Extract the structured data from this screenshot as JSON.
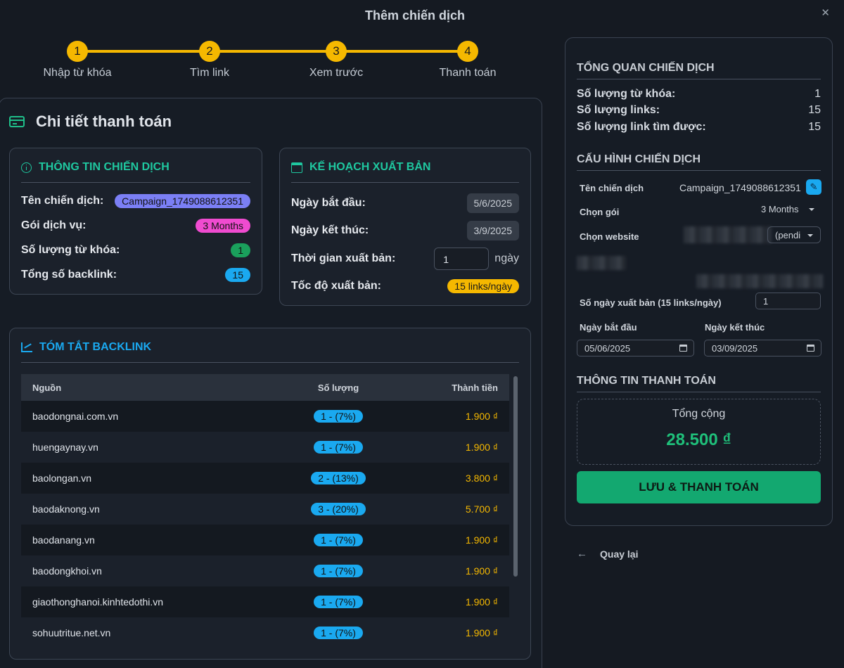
{
  "modal": {
    "title": "Thêm chiến dịch"
  },
  "stepper": [
    {
      "num": "1",
      "label": "Nhập từ khóa"
    },
    {
      "num": "2",
      "label": "Tìm link"
    },
    {
      "num": "3",
      "label": "Xem trước"
    },
    {
      "num": "4",
      "label": "Thanh toán"
    }
  ],
  "payment": {
    "title": "Chi tiết thanh toán"
  },
  "campaign_info": {
    "title": "THÔNG TIN CHIẾN DỊCH",
    "name_label": "Tên chiến dịch:",
    "name_value": "Campaign_1749088612351",
    "package_label": "Gói dịch vụ:",
    "package_value": "3 Months",
    "keywords_label": "Số lượng từ khóa:",
    "keywords_value": "1",
    "backlinks_label": "Tổng số backlink:",
    "backlinks_value": "15"
  },
  "plan": {
    "title": "KẾ HOẠCH XUẤT BẢN",
    "start_label": "Ngày bắt đầu:",
    "start_value": "5/6/2025",
    "end_label": "Ngày kết thúc:",
    "end_value": "3/9/2025",
    "duration_label": "Thời gian xuất bản:",
    "duration_value": "1",
    "duration_unit": "ngày",
    "speed_label": "Tốc độ xuất bản:",
    "speed_value": "15 links/ngày"
  },
  "backlinks": {
    "title": "TÓM TẮT BACKLINK",
    "headers": {
      "source": "Nguồn",
      "qty": "Số lượng",
      "amount": "Thành tiền"
    },
    "rows": [
      {
        "source": "baodongnai.com.vn",
        "qty": "1 - (7%)",
        "amount": "1.900 ₫"
      },
      {
        "source": "huengaynay.vn",
        "qty": "1 - (7%)",
        "amount": "1.900 ₫"
      },
      {
        "source": "baolongan.vn",
        "qty": "2 - (13%)",
        "amount": "3.800 ₫"
      },
      {
        "source": "baodaknong.vn",
        "qty": "3 - (20%)",
        "amount": "5.700 ₫"
      },
      {
        "source": "baodanang.vn",
        "qty": "1 - (7%)",
        "amount": "1.900 ₫"
      },
      {
        "source": "baodongkhoi.vn",
        "qty": "1 - (7%)",
        "amount": "1.900 ₫"
      },
      {
        "source": "giaothonghanoi.kinhtedothi.vn",
        "qty": "1 - (7%)",
        "amount": "1.900 ₫"
      },
      {
        "source": "sohuutritue.net.vn",
        "qty": "1 - (7%)",
        "amount": "1.900 ₫"
      }
    ]
  },
  "overview": {
    "title": "TỔNG QUAN CHIẾN DỊCH",
    "keywords_label": "Số lượng từ khóa:",
    "keywords_value": "1",
    "links_label": "Số lượng links:",
    "links_value": "15",
    "found_label": "Số lượng link tìm được:",
    "found_value": "15"
  },
  "config": {
    "title": "CẤU HÌNH CHIẾN DỊCH",
    "name_label": "Tên chiến dịch",
    "name_value": "Campaign_1749088612351",
    "package_label": "Chọn gói",
    "package_value": "3 Months",
    "website_label": "Chọn website",
    "website_value": "(pendi",
    "days_label": "Số ngày xuất bản (15 links/ngày)",
    "days_value": "1",
    "start_label": "Ngày bắt đầu",
    "start_value": "05/06/2025",
    "end_label": "Ngày kết thúc",
    "end_value": "03/09/2025"
  },
  "payment_info": {
    "title": "THÔNG TIN THANH TOÁN",
    "total_label": "Tổng cộng",
    "total_value": "28.500 ₫",
    "pay_button": "LƯU & THANH TOÁN"
  },
  "back": {
    "label": "Quay lại"
  },
  "icons": {
    "close": "close-icon",
    "edit": "pencil-icon",
    "back": "arrow-left-icon"
  },
  "colors": {
    "accent": "#f5b800",
    "green": "#13a870",
    "teal": "#1fc8a0",
    "blue": "#1aa9f0"
  }
}
